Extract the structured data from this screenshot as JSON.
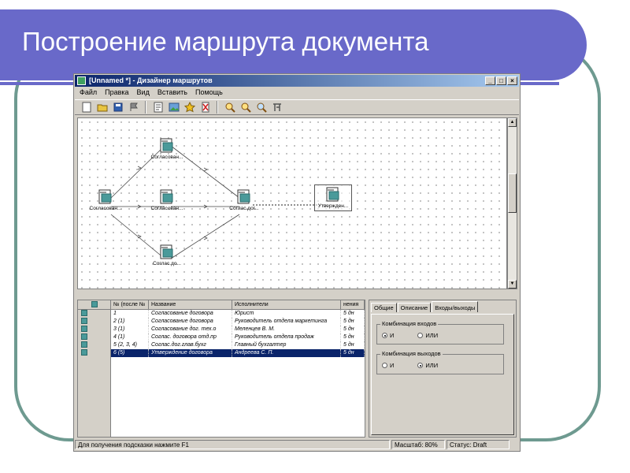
{
  "slide": {
    "title": "Построение маршрута документа"
  },
  "window": {
    "title": "[Unnamed *] - Дизайнер маршрутов",
    "controls": {
      "minimize": "_",
      "maximize": "□",
      "close": "×"
    }
  },
  "menu": [
    "Файл",
    "Правка",
    "Вид",
    "Вставить",
    "Помощь"
  ],
  "toolbar": {
    "icons": [
      "new-icon",
      "open-icon",
      "save-icon",
      "flag-icon",
      "document-icon",
      "image-icon",
      "star-icon",
      "delete-icon",
      "zoom-in-icon",
      "zoom-out-icon",
      "zoom-fit-icon",
      "settings-icon"
    ]
  },
  "diagram": {
    "nodes": [
      {
        "label": "Согласован..."
      },
      {
        "label": "Согласован..."
      },
      {
        "label": "Согласован..."
      },
      {
        "label": "Соглас.до..."
      },
      {
        "label": "Соглас.дог..."
      },
      {
        "label": "Утвержден..."
      }
    ]
  },
  "grid": {
    "columns": [
      "№ (после №",
      "Название",
      "Исполнители",
      "нения"
    ],
    "rows": [
      {
        "num": "1",
        "name": "Согласование договора",
        "performer": "Юрист",
        "term": "5 дн"
      },
      {
        "num": "2 (1)",
        "name": "Согласование договора",
        "performer": "Руководитель отдела маркетинга",
        "term": "5 дн"
      },
      {
        "num": "3 (1)",
        "name": "Согласование дог. тех.о",
        "performer": "Меленцев В. М.",
        "term": "5 дн"
      },
      {
        "num": "4 (1)",
        "name": "Соглас. договора отд.пр",
        "performer": "Руководитель отдела продаж",
        "term": "5 дн"
      },
      {
        "num": "5 (2, 3, 4)",
        "name": "Соглас.дог.глав.бухг",
        "performer": "Главный бухгалтер",
        "term": "5 дн"
      },
      {
        "num": "6 (5)",
        "name": "Утверждение договора",
        "performer": "Андреева С. П.",
        "term": "5 дн",
        "selected": true
      }
    ]
  },
  "properties": {
    "tabs": [
      "Общие",
      "Описание",
      "Входы/выходы"
    ],
    "active_tab": "Входы/выходы",
    "groups": [
      {
        "title": "Комбинация входов",
        "options": [
          "И",
          "ИЛИ"
        ],
        "selected": "И"
      },
      {
        "title": "Комбинация выходов",
        "options": [
          "И",
          "ИЛИ"
        ],
        "selected": "ИЛИ"
      }
    ]
  },
  "statusbar": {
    "hint": "Для получения подсказки нажмите F1",
    "zoom": "Масштаб: 80%",
    "status": "Статус: Draft"
  },
  "colors": {
    "title_band": "#6969c9",
    "frame_outline": "#6e9a90",
    "selection": "#0a246a",
    "node_icon": "#4a9a9a"
  }
}
